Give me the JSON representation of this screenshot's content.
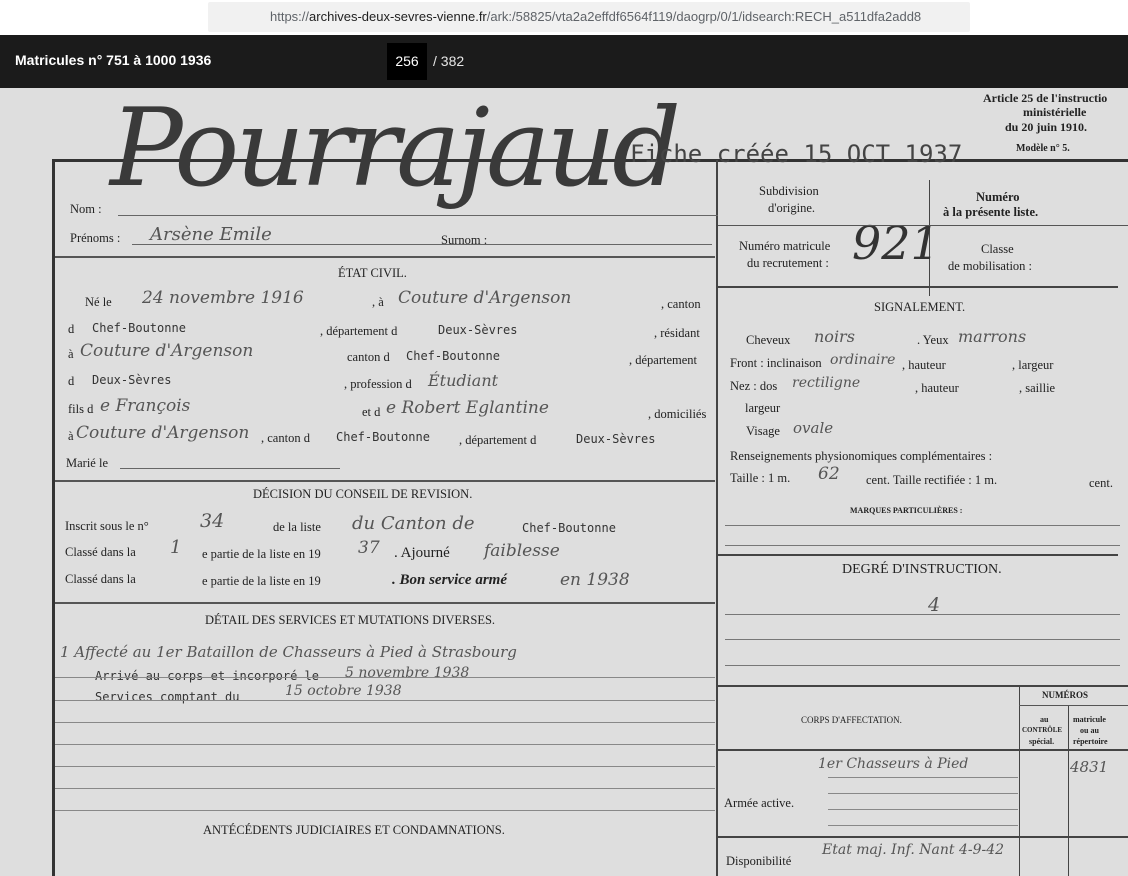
{
  "browser": {
    "url_prefix": "https://",
    "url_domain": "archives-deux-sevres-vienne.fr",
    "url_path": "/ark:/58825/vta2a2effdf6564f119/daogrp/0/1/idsearch:RECH_a511dfa2add8"
  },
  "viewer": {
    "title": "Matricules n° 751 à 1000 1936",
    "current_page": "256",
    "total_pages": "/ 382"
  },
  "doc": {
    "article_line1": "Article 25 de l'instructio",
    "article_line2": "ministérielle",
    "article_line3": "du 20 juin 1910.",
    "modele": "Modèle n° 5.",
    "surname_hw": "Pourrajaud",
    "stamp": "Fiche   créée  15 OCT 1937",
    "nom_label": "Nom :",
    "prenoms_label": "Prénoms :",
    "prenoms_hw": "Arsène Emile",
    "surnom_label": "Surnom :",
    "etat_civil": "ÉTAT CIVIL.",
    "ne_le_label": "Né le",
    "ne_le_hw": "24 novembre 1916",
    "a_label": ", à",
    "a_hw": "Couture d'Argenson",
    "canton_label": ", canton",
    "d1_label": "d",
    "chef_boutonne_1": "Chef-Boutonne",
    "departement_label": ", département d",
    "deux_sevres_1": "Deux-Sèvres",
    "residant_label": ", résidant",
    "a2_label": "à",
    "a2_hw": "Couture d'Argenson",
    "canton_d_label": "canton d",
    "chef_boutonne_2": "Chef-Boutonne",
    "departement2_label": ", département",
    "d2_label": "d",
    "deux_sevres_2": "Deux-Sèvres",
    "profession_label": ", profession d",
    "profession_hw": "Étudiant",
    "fils_label": "fils d",
    "pere_hw": "e François",
    "et_label": "et d",
    "mere_hw": "e Robert Eglantine",
    "domicilies_label": ", domiciliés",
    "a3_label": "à",
    "a3_hw": "Couture d'Argenson",
    "canton3_label": ", canton d",
    "chef_boutonne_3": "Chef-Boutonne",
    "departement3_label": ", département d",
    "deux_sevres_3": "Deux-Sèvres",
    "marie_label": "Marié le",
    "decision": "DÉCISION DU CONSEIL DE REVISION.",
    "inscrit_label": "Inscrit sous le n°",
    "inscrit_hw": "34",
    "de_la_liste": "de la liste",
    "liste_hw": "du Canton de",
    "chef_boutonne_4": "Chef-Boutonne",
    "classe1_label": "Classé dans la",
    "classe1_hw": "1",
    "classe1_mid": "e partie de la liste en 19",
    "classe1_year": "37",
    "ajourne": ". Ajourné",
    "faiblesse_hw": "faiblesse",
    "classe2_label": "Classé dans la",
    "classe2_mid": "e partie de la liste en 19",
    "bon_service": ". Bon service armé",
    "bon_service_hw": "en 1938",
    "detail": "DÉTAIL DES SERVICES ET MUTATIONS DIVERSES.",
    "affecte_hw": "1 Affecté au 1er Bataillon de Chasseurs à Pied à Strasbourg",
    "arrive": "Arrivé au corps et incorporé le",
    "arrive_hw": "5 novembre 1938",
    "services": "Services comptant du",
    "services_hw": "15 octobre 1938",
    "antecedents": "ANTÉCÉDENTS JUDICIAIRES ET CONDAMNATIONS.",
    "subdivision": "Subdivision",
    "origine": "d'origine.",
    "numero": "Numéro",
    "presente_liste": "à la présente liste.",
    "numero_matricule": "Numéro matricule",
    "du_recrutement": "du recrutement :",
    "matricule_hw": "921",
    "classe_label": "Classe",
    "mobilisation": "de mobilisation :",
    "signalement": "SIGNALEMENT.",
    "cheveux": "Cheveux",
    "cheveux_hw": "noirs",
    "yeux": ". Yeux",
    "yeux_hw": "marrons",
    "front": "Front : inclinaison",
    "front_hw": "ordinaire",
    "hauteur": ", hauteur",
    "largeur": ", largeur",
    "nez": "Nez : dos",
    "nez_hw": "rectiligne",
    "saillie": ", saillie",
    "largeur2": "largeur",
    "visage": "Visage",
    "visage_hw": "ovale",
    "renseignements": "Renseignements physionomiques complémentaires :",
    "taille": "Taille : 1 m.",
    "taille_hw": "62",
    "cent": "cent. Taille rectifiée : 1 m.",
    "cent2": "cent.",
    "marques": "MARQUES PARTICULIÈRES :",
    "degre": "DEGRÉ D'INSTRUCTION.",
    "degre_hw": "4",
    "numeros": "NUMÉROS",
    "corps": "CORPS D'AFFECTATION.",
    "au_controle": "au",
    "controle_special": "CONTRÔLE",
    "special": "spécial.",
    "matricule_col": "matricule",
    "ou_au": "ou au",
    "repertoire": "répertoire",
    "armee_active": "Armée active.",
    "armee_hw": "1er Chasseurs à Pied",
    "armee_num_hw": "4831",
    "disponibilite": "Disponibilité",
    "dispo_hw": "Etat maj. Inf. Nant 4-9-42"
  }
}
